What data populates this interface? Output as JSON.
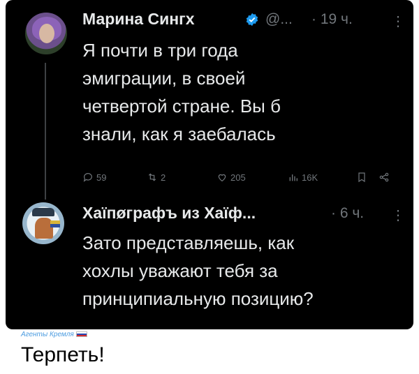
{
  "tweet1": {
    "author": "Марина Сингх",
    "handle": "@...",
    "time": "· 19 ч.",
    "text_lines": [
      "Я почти в три года",
      "эмиграции, в своей",
      "четвертой стране. Вы б",
      "знали, как я заебалась"
    ],
    "stats": {
      "replies": "59",
      "retweets": "2",
      "likes": "205",
      "views": "16K"
    },
    "verified_color": "#1d9bf0",
    "icons": [
      "reply-icon",
      "retweet-icon",
      "like-icon",
      "views-icon",
      "bookmark-icon",
      "share-icon",
      "more-icon"
    ]
  },
  "tweet2": {
    "author": "Хаїпøграфъ из Хаїф...",
    "time": "· 6 ч.",
    "text_lines": [
      "Зато представляешь, как",
      "хохлы уважают тебя за",
      "принципиальную позицию?"
    ],
    "icons": [
      "more-icon"
    ]
  },
  "caption": {
    "tag": "Агенты Кремля",
    "text": "Терпеть!"
  },
  "colors": {
    "background": "#000000",
    "primary_text": "#e7e9ea",
    "secondary_text": "#71767b",
    "tag_color": "#4a9be0"
  }
}
